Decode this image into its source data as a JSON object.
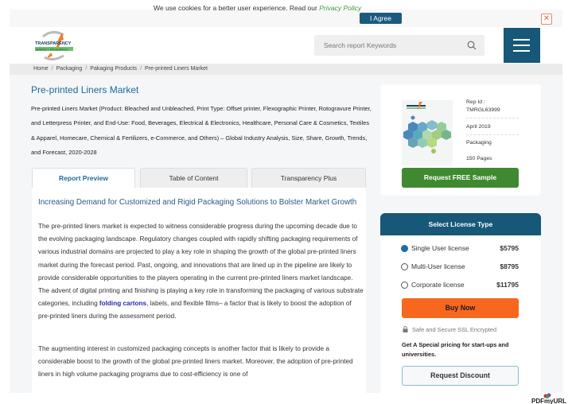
{
  "cookie_bar": {
    "text": "We use cookies for a better user experience. Read our ",
    "privacy_link": "Privacy Policy",
    "agree_label": "I Agree",
    "close_icon": "close-icon"
  },
  "header": {
    "logo_line1": "TRANSPARENCY",
    "logo_line2": "MARKET RESEARCH",
    "search_placeholder": "Search report Keywords",
    "search_icon": "search-icon",
    "menu_icon": "hamburger-menu-icon"
  },
  "breadcrumb": [
    "Home",
    "Packaging",
    "Pakaging Products",
    "Pre-printed Liners Market"
  ],
  "report": {
    "title": "Pre-printed Liners Market",
    "subtitle": "Pre-printed Liners Market (Product: Bleached and Unbleached, Print Type: Offset printer, Flexographic Printer, Rotogravure Printer, and Letterpress Printer, and End-Use: Food, Beverages, Electrical & Electronics, Healthcare, Personal Care & Cosmetics, Textiles & Apparel, Homecare, Chemical & Fertilizers, e-Commerce, and Others) – Global Industry Analysis, Size, Share, Growth, Trends, and Forecast, 2020-2028",
    "rep_id_label": "Rep Id :",
    "rep_id": "TMRGL63999",
    "date": "April 2019",
    "category": "Packaging",
    "pages": "150 Pages",
    "sample_button": "Request FREE Sample"
  },
  "tabs": [
    {
      "label": "Report Preview",
      "active": true
    },
    {
      "label": "Table of Content",
      "active": false
    },
    {
      "label": "Transparency Plus",
      "active": false
    }
  ],
  "content": {
    "section_title": "Increasing Demand for Customized and Rigid Packaging Solutions to Bolster Market Growth",
    "para1_before": "The pre-printed liners market is expected to witness considerable progress during the upcoming decade due to the evolving packaging landscape. Regulatory changes coupled with rapidly shifting packaging requirements of various industrial domains are projected to play a key role in shaping the growth of the global pre-printed liners market during the forecast period. Past, ongoing, and innovations that are lined up in the pipeline are likely to provide considerable opportunities to the players operating in the current pre-printed liners market landscape. The advent of digital printing and finishing is playing a key role in transforming the packaging of various substrate categories, including ",
    "para1_link": "folding cartons",
    "para1_after": ", labels, and flexible films– a factor that is likely to boost the adoption of pre-printed liners during the assessment period.",
    "para2": "The augmenting interest in customized packaging concepts is another factor that is likely to provide a considerable boost to the growth of the global pre-printed liners market. Moreover, the adoption of pre-printed liners in high volume packaging programs due to cost-efficiency is one of"
  },
  "license": {
    "header": "Select License Type",
    "options": [
      {
        "label": "Single User license",
        "price": "$5795",
        "selected": true
      },
      {
        "label": "Multi-User license",
        "price": "$8795",
        "selected": false
      },
      {
        "label": "Corporate license",
        "price": "$11795",
        "selected": false
      }
    ],
    "buy_button": "Buy Now",
    "ssl_text": "Safe and Secure SSL Encrypted",
    "special_text": "Get A Special pricing for start-ups and universities.",
    "discount_button": "Request Discount"
  },
  "watermark": "PDFmyURL",
  "colors": {
    "brand_blue": "#175878",
    "title_blue": "#1e6a96",
    "sample_green": "#3f8a30",
    "buy_orange": "#f7681e",
    "privacy_green": "#3c9a3c"
  }
}
